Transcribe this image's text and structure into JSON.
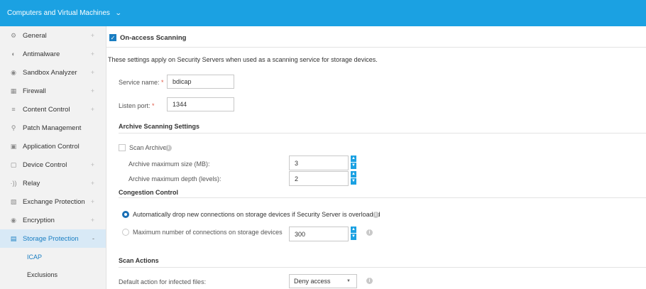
{
  "topbar": {
    "title": "Computers and Virtual Machines"
  },
  "sidebar": {
    "items": [
      {
        "label": "General",
        "plus": "+"
      },
      {
        "label": "Antimalware",
        "plus": "+"
      },
      {
        "label": "Sandbox Analyzer",
        "plus": "+"
      },
      {
        "label": "Firewall",
        "plus": "+"
      },
      {
        "label": "Content Control",
        "plus": "+"
      },
      {
        "label": "Patch Management",
        "plus": ""
      },
      {
        "label": "Application Control",
        "plus": ""
      },
      {
        "label": "Device Control",
        "plus": "+"
      },
      {
        "label": "Relay",
        "plus": "+"
      },
      {
        "label": "Exchange Protection",
        "plus": "+"
      },
      {
        "label": "Encryption",
        "plus": "+"
      },
      {
        "label": "Storage Protection",
        "plus": "-"
      }
    ],
    "sub_items": [
      {
        "label": "ICAP"
      },
      {
        "label": "Exclusions"
      }
    ]
  },
  "main": {
    "on_access_label": "On-access Scanning",
    "description": "These settings apply on Security Servers when used as a scanning service for storage devices.",
    "service_name": {
      "label": "Service name:",
      "required": "*",
      "value": "bdicap"
    },
    "listen_port": {
      "label": "Listen port:",
      "required": "*",
      "value": "1344"
    },
    "archive_heading": "Archive Scanning Settings",
    "scan_archive_label": "Scan Archive",
    "archive_max_size": {
      "label": "Archive maximum size (MB):",
      "value": "3"
    },
    "archive_max_depth": {
      "label": "Archive maximum depth (levels):",
      "value": "2"
    },
    "congestion_heading": "Congestion Control",
    "auto_drop_label": "Automatically drop new connections on storage devices if Security Server is overloaded",
    "max_conn_label": "Maximum number of connections on storage devices",
    "max_conn_value": "300",
    "scan_actions_heading": "Scan Actions",
    "default_action_label": "Default action for infected files:",
    "default_action_value": "Deny access"
  }
}
